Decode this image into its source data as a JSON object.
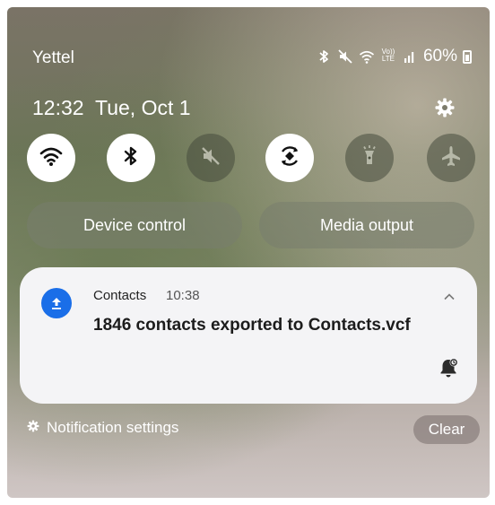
{
  "status_bar": {
    "carrier": "Yettel",
    "volte_label_top": "Vo))",
    "volte_label_bottom": "LTE",
    "battery": "60%",
    "icons": [
      "bluetooth-icon",
      "mute-icon",
      "wifi-icon",
      "volte-icon",
      "signal-icon",
      "battery-icon"
    ]
  },
  "header": {
    "time": "12:32",
    "date": "Tue, Oct 1",
    "settings_icon": "gear-icon"
  },
  "quick_toggles": [
    {
      "name": "wifi",
      "icon": "wifi-icon",
      "active": true
    },
    {
      "name": "bluetooth",
      "icon": "bluetooth-icon",
      "active": true
    },
    {
      "name": "sound",
      "icon": "mute-icon",
      "active": false
    },
    {
      "name": "auto-rotate",
      "icon": "rotate-icon",
      "active": true
    },
    {
      "name": "flashlight",
      "icon": "flashlight-icon",
      "active": false
    },
    {
      "name": "airplane",
      "icon": "airplane-icon",
      "active": false
    }
  ],
  "quick_buttons": {
    "device_control": "Device control",
    "media_output": "Media output"
  },
  "notification": {
    "app": "Contacts",
    "time": "10:38",
    "title": "1846 contacts exported to Contacts.vcf",
    "app_icon": "upload-icon",
    "accent": "#1a6ee8"
  },
  "footer": {
    "settings_label": "Notification settings",
    "clear_label": "Clear"
  }
}
